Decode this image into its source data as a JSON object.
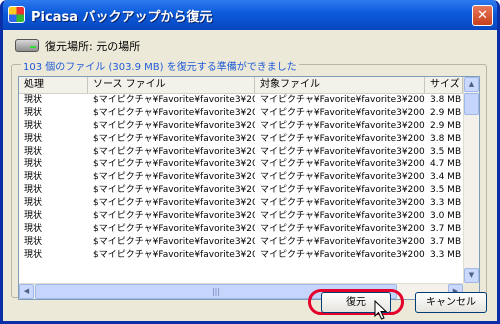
{
  "window": {
    "title": "Picasa バックアップから復元",
    "close_glyph": "✕"
  },
  "restore_location": "復元場所: 元の場所",
  "group_title": "103 個のファイル (303.9 MB) を復元する準備ができました",
  "table": {
    "headers": [
      "処理",
      "ソース ファイル",
      "対象ファイル",
      "サイズ"
    ],
    "rows": [
      [
        "現状",
        "$マイピクチャ¥Favorite¥favorite3¥2005...",
        "マイピクチャ¥Favorite¥favorite3¥2005-t...",
        "3.8 MB"
      ],
      [
        "現状",
        "$マイピクチャ¥Favorite¥favorite3¥2005...",
        "マイピクチャ¥Favorite¥favorite3¥2005-t...",
        "2.9 MB"
      ],
      [
        "現状",
        "$マイピクチャ¥Favorite¥favorite3¥2005...",
        "マイピクチャ¥Favorite¥favorite3¥2005-t...",
        "2.9 MB"
      ],
      [
        "現状",
        "$マイピクチャ¥Favorite¥favorite3¥2005...",
        "マイピクチャ¥Favorite¥favorite3¥2005-t...",
        "3.8 MB"
      ],
      [
        "現状",
        "$マイピクチャ¥Favorite¥favorite3¥2005...",
        "マイピクチャ¥Favorite¥favorite3¥2005-t...",
        "3.5 MB"
      ],
      [
        "現状",
        "$マイピクチャ¥Favorite¥favorite3¥2005...",
        "マイピクチャ¥Favorite¥favorite3¥2005-t...",
        "4.7 MB"
      ],
      [
        "現状",
        "$マイピクチャ¥Favorite¥favorite3¥2005...",
        "マイピクチャ¥Favorite¥favorite3¥2005-t...",
        "3.4 MB"
      ],
      [
        "現状",
        "$マイピクチャ¥Favorite¥favorite3¥2005...",
        "マイピクチャ¥Favorite¥favorite3¥2005-t...",
        "3.5 MB"
      ],
      [
        "現状",
        "$マイピクチャ¥Favorite¥favorite3¥2005...",
        "マイピクチャ¥Favorite¥favorite3¥2005-t...",
        "3.3 MB"
      ],
      [
        "現状",
        "$マイピクチャ¥Favorite¥favorite3¥2005...",
        "マイピクチャ¥Favorite¥favorite3¥2005-t...",
        "3.0 MB"
      ],
      [
        "現状",
        "$マイピクチャ¥Favorite¥favorite3¥2005...",
        "マイピクチャ¥Favorite¥favorite3¥2005-t...",
        "3.7 MB"
      ],
      [
        "現状",
        "$マイピクチャ¥Favorite¥favorite3¥2005...",
        "マイピクチャ¥Favorite¥favorite3¥2005-t...",
        "3.7 MB"
      ],
      [
        "現状",
        "$マイピクチャ¥Favorite¥favorite3¥2005...",
        "マイピクチャ¥Favorite¥favorite3¥2005-t...",
        "3.3 MB"
      ]
    ]
  },
  "buttons": {
    "restore": "復元",
    "cancel": "キャンセル"
  },
  "scroll": {
    "up": "▲",
    "down": "▼",
    "left": "◀",
    "right": "▶",
    "grip": "|||"
  },
  "colors": {
    "titlebar": "#0b5ad9",
    "highlight": "#e5002b",
    "group_title": "#1f5ad8"
  }
}
